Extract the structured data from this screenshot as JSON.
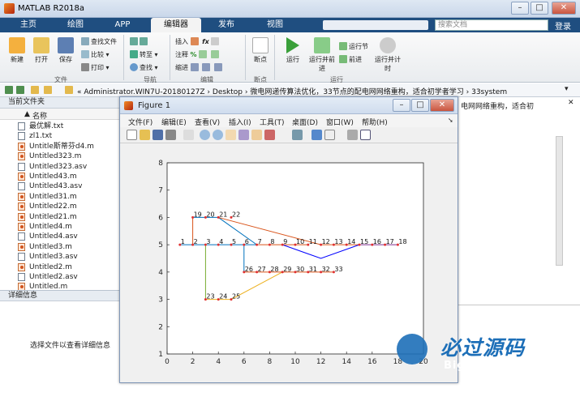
{
  "app": {
    "title": "MATLAB R2018a",
    "login": "登录",
    "search_placeholder": "搜索文档"
  },
  "ribbon_tabs": [
    "主页",
    "绘图",
    "APP",
    "编辑器",
    "发布",
    "视图"
  ],
  "toolbar": {
    "new": "新建",
    "open": "打开",
    "save": "保存",
    "find_files": "查找文件",
    "compare": "比较",
    "print": "打印",
    "goto": "转至",
    "find": "查找",
    "insert": "插入",
    "comment": "注释",
    "indent": "缩进",
    "breakpoint": "断点",
    "run": "运行",
    "run_advance": "运行并前进",
    "run_section": "运行节",
    "advance": "前进",
    "run_time": "运行并计时",
    "groups": {
      "file": "文件",
      "nav": "导航",
      "edit": "编辑",
      "bp": "断点",
      "run": "运行"
    }
  },
  "address": "« Administrator.WIN7U-20180127Z › Desktop › 微电网递传算法优化，33节点的配电网网络重构，适合初学者学习 › 33system",
  "current_folder": {
    "title": "当前文件夹",
    "column": "名称",
    "files": [
      {
        "name": "最优解.txt",
        "type": "txt"
      },
      {
        "name": "zl1.txt",
        "type": "txt"
      },
      {
        "name": "Untitle斯蒂芬d4.m",
        "type": "m"
      },
      {
        "name": "Untitled323.m",
        "type": "m"
      },
      {
        "name": "Untitled323.asv",
        "type": "txt"
      },
      {
        "name": "Untitled43.m",
        "type": "m"
      },
      {
        "name": "Untitled43.asv",
        "type": "txt"
      },
      {
        "name": "Untitled31.m",
        "type": "m"
      },
      {
        "name": "Untitled22.m",
        "type": "m"
      },
      {
        "name": "Untitled21.m",
        "type": "m"
      },
      {
        "name": "Untitled4.m",
        "type": "m"
      },
      {
        "name": "Untitled4.asv",
        "type": "txt"
      },
      {
        "name": "Untitled3.m",
        "type": "m"
      },
      {
        "name": "Untitled3.asv",
        "type": "txt"
      },
      {
        "name": "Untitled2.m",
        "type": "m"
      },
      {
        "name": "Untitled2.asv",
        "type": "txt"
      },
      {
        "name": "Untitled.m",
        "type": "m"
      }
    ]
  },
  "details": {
    "title": "详细信息",
    "message": "选择文件以查看详细信息"
  },
  "right_snippet": "电网网络重构，适合初",
  "figure": {
    "title": "Figure 1",
    "menu": [
      "文件(F)",
      "编辑(E)",
      "查看(V)",
      "插入(I)",
      "工具(T)",
      "桌面(D)",
      "窗口(W)",
      "帮助(H)"
    ]
  },
  "chart_data": {
    "type": "line",
    "xlim": [
      0,
      20
    ],
    "ylim": [
      1,
      8
    ],
    "xticks": [
      0,
      2,
      4,
      6,
      8,
      10,
      12,
      14,
      16,
      18,
      20
    ],
    "yticks": [
      1,
      2,
      3,
      4,
      5,
      6,
      7,
      8
    ],
    "nodes": [
      {
        "id": 1,
        "x": 1,
        "y": 5
      },
      {
        "id": 2,
        "x": 2,
        "y": 5
      },
      {
        "id": 3,
        "x": 3,
        "y": 5
      },
      {
        "id": 4,
        "x": 4,
        "y": 5
      },
      {
        "id": 5,
        "x": 5,
        "y": 5
      },
      {
        "id": 6,
        "x": 6,
        "y": 5
      },
      {
        "id": 7,
        "x": 7,
        "y": 5
      },
      {
        "id": 8,
        "x": 8,
        "y": 5
      },
      {
        "id": 9,
        "x": 9,
        "y": 5
      },
      {
        "id": 10,
        "x": 10,
        "y": 5
      },
      {
        "id": 11,
        "x": 11,
        "y": 5
      },
      {
        "id": 12,
        "x": 12,
        "y": 5
      },
      {
        "id": 13,
        "x": 13,
        "y": 5
      },
      {
        "id": 14,
        "x": 14,
        "y": 5
      },
      {
        "id": 15,
        "x": 15,
        "y": 5
      },
      {
        "id": 16,
        "x": 16,
        "y": 5
      },
      {
        "id": 17,
        "x": 17,
        "y": 5
      },
      {
        "id": 18,
        "x": 18,
        "y": 5
      },
      {
        "id": 19,
        "x": 2,
        "y": 6
      },
      {
        "id": 20,
        "x": 3,
        "y": 6
      },
      {
        "id": 21,
        "x": 4,
        "y": 6
      },
      {
        "id": 22,
        "x": 5,
        "y": 6
      },
      {
        "id": 23,
        "x": 3,
        "y": 3
      },
      {
        "id": 24,
        "x": 4,
        "y": 3
      },
      {
        "id": 25,
        "x": 5,
        "y": 3
      },
      {
        "id": 26,
        "x": 6,
        "y": 4
      },
      {
        "id": 27,
        "x": 7,
        "y": 4
      },
      {
        "id": 28,
        "x": 8,
        "y": 4
      },
      {
        "id": 29,
        "x": 9,
        "y": 4
      },
      {
        "id": 30,
        "x": 10,
        "y": 4
      },
      {
        "id": 31,
        "x": 11,
        "y": 4
      },
      {
        "id": 32,
        "x": 12,
        "y": 4
      },
      {
        "id": 33,
        "x": 13,
        "y": 4
      }
    ],
    "series": [
      {
        "color": "#0072bd",
        "points": [
          [
            1,
            5
          ],
          [
            7,
            5
          ]
        ]
      },
      {
        "color": "#0072bd",
        "points": [
          [
            2,
            6
          ],
          [
            4,
            6
          ],
          [
            7,
            5
          ]
        ]
      },
      {
        "color": "#0072bd",
        "points": [
          [
            6,
            5
          ],
          [
            6,
            4
          ]
        ]
      },
      {
        "color": "#d95319",
        "points": [
          [
            2,
            6
          ],
          [
            2,
            5
          ]
        ]
      },
      {
        "color": "#d95319",
        "points": [
          [
            4,
            6
          ],
          [
            12,
            5
          ],
          [
            15,
            5
          ]
        ]
      },
      {
        "color": "#d95319",
        "points": [
          [
            6,
            4
          ],
          [
            13,
            4
          ]
        ]
      },
      {
        "color": "#d95319",
        "points": [
          [
            7,
            5
          ],
          [
            11,
            5
          ]
        ]
      },
      {
        "color": "#edb120",
        "points": [
          [
            3,
            3
          ],
          [
            5,
            3
          ],
          [
            9,
            4
          ]
        ]
      },
      {
        "color": "#77ac30",
        "points": [
          [
            3,
            5
          ],
          [
            3,
            3
          ]
        ]
      },
      {
        "color": "#7e2f8e",
        "points": [
          [
            15,
            5
          ],
          [
            18,
            5
          ]
        ]
      },
      {
        "color": "#0000ff",
        "points": [
          [
            9,
            5
          ],
          [
            12,
            4.5
          ],
          [
            15,
            5
          ]
        ]
      }
    ]
  },
  "watermark": {
    "line1": "必过源码",
    "line2": "Biguo100.com"
  }
}
